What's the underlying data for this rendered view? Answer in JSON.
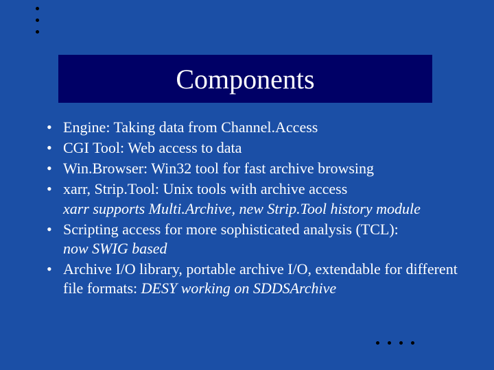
{
  "title": "Components",
  "bullets": [
    {
      "text": "Engine: Taking data from Channel.Access"
    },
    {
      "text": "CGI Tool: Web access to data"
    },
    {
      "text": "Win.Browser: Win32 tool for fast archive browsing"
    },
    {
      "text": "xarr, Strip.Tool: Unix tools with archive access",
      "sub": "xarr supports Multi.Archive, new Strip.Tool history module"
    },
    {
      "text": "Scripting access for more sophisticated analysis (TCL):",
      "sub": "now SWIG based"
    },
    {
      "text": "Archive I/O library, portable archive I/O, extendable for different file formats: ",
      "inlineSub": "DESY working on SDDSArchive"
    }
  ]
}
